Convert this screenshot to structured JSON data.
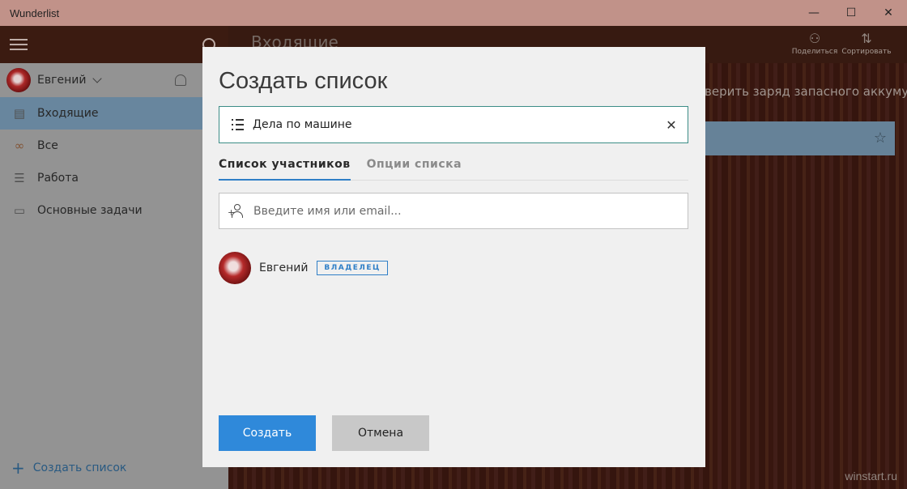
{
  "window": {
    "title": "Wunderlist",
    "minimize": "—",
    "maximize": "☐",
    "close": "✕"
  },
  "sidebar": {
    "user_name": "Евгений",
    "items": [
      {
        "label": "Входящие",
        "icon": "inbox-icon",
        "active": true
      },
      {
        "label": "Все",
        "icon": "infinity-icon",
        "active": false
      },
      {
        "label": "Работа",
        "icon": "list-icon",
        "active": false
      },
      {
        "label": "Основные задачи",
        "icon": "folder-icon",
        "active": false
      }
    ],
    "create_list": "Создать список"
  },
  "main": {
    "title": "Входящие",
    "share_label": "Поделиться",
    "sort_label": "Сортировать",
    "task_text": "верить заряд запасного аккумулят",
    "bottom_text": "..."
  },
  "watermark": "winstart.ru",
  "dialog": {
    "title": "Создать список",
    "list_name": "Дела по машине",
    "tabs": [
      "Список участников",
      "Опции списка"
    ],
    "member_placeholder": "Введите имя или email...",
    "member": {
      "name": "Евгений",
      "badge": "ВЛАДЕЛЕЦ"
    },
    "create_label": "Создать",
    "cancel_label": "Отмена"
  },
  "colors": {
    "accent": "#2f89da",
    "title_bar": "#c19289",
    "sidebar_active": "#6e8ea7",
    "input_focus_border": "#3c8d86"
  }
}
